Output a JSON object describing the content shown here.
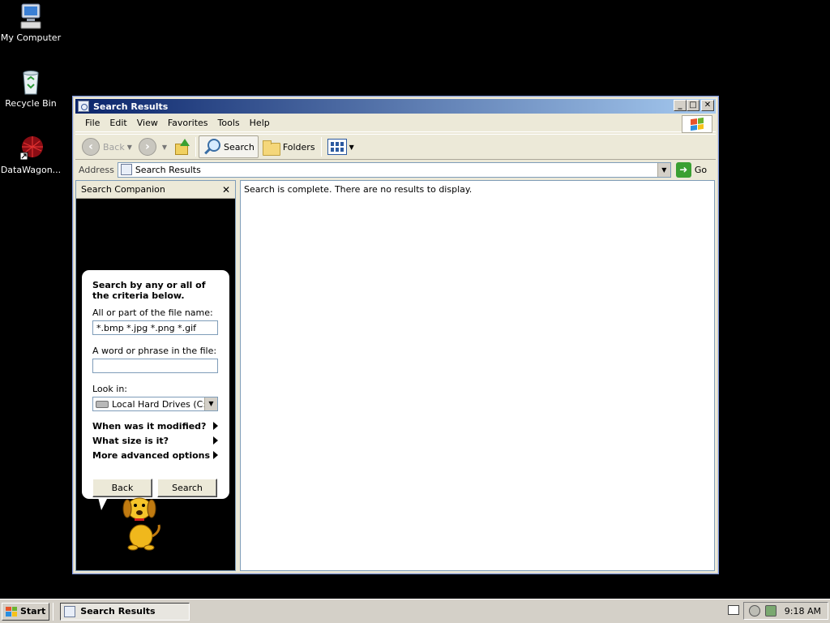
{
  "desktop": {
    "icons": [
      {
        "label": "My Computer"
      },
      {
        "label": "Recycle Bin"
      },
      {
        "label": "DataWagon..."
      }
    ]
  },
  "window": {
    "title": "Search Results",
    "controls": {
      "minimize": "_",
      "maximize": "□",
      "close": "✕"
    },
    "menu": [
      "File",
      "Edit",
      "View",
      "Favorites",
      "Tools",
      "Help"
    ],
    "toolbar": {
      "back": "Back",
      "search": "Search",
      "folders": "Folders"
    },
    "address": {
      "label": "Address",
      "value": "Search Results",
      "go": "Go"
    },
    "search_companion": {
      "title": "Search Companion",
      "heading": "Search by any or all of the criteria below.",
      "filename_label": "All or part of the file name:",
      "filename_value": "*.bmp *.jpg *.png *.gif",
      "phrase_label": "A word or phrase in the file:",
      "phrase_value": "",
      "lookin_label": "Look in:",
      "lookin_value": "Local Hard Drives (C:)",
      "options": [
        "When was it modified?",
        "What size is it?",
        "More advanced options"
      ],
      "back_button": "Back",
      "search_button": "Search"
    },
    "results": {
      "message": "Search is complete. There are no results to display."
    }
  },
  "taskbar": {
    "start": "Start",
    "task": "Search Results",
    "clock": "9:18 AM"
  },
  "colors": {
    "title_gradient_start": "#0a246a",
    "title_gradient_end": "#a6caf0",
    "desktop": "#000000",
    "face": "#ece9d8"
  }
}
